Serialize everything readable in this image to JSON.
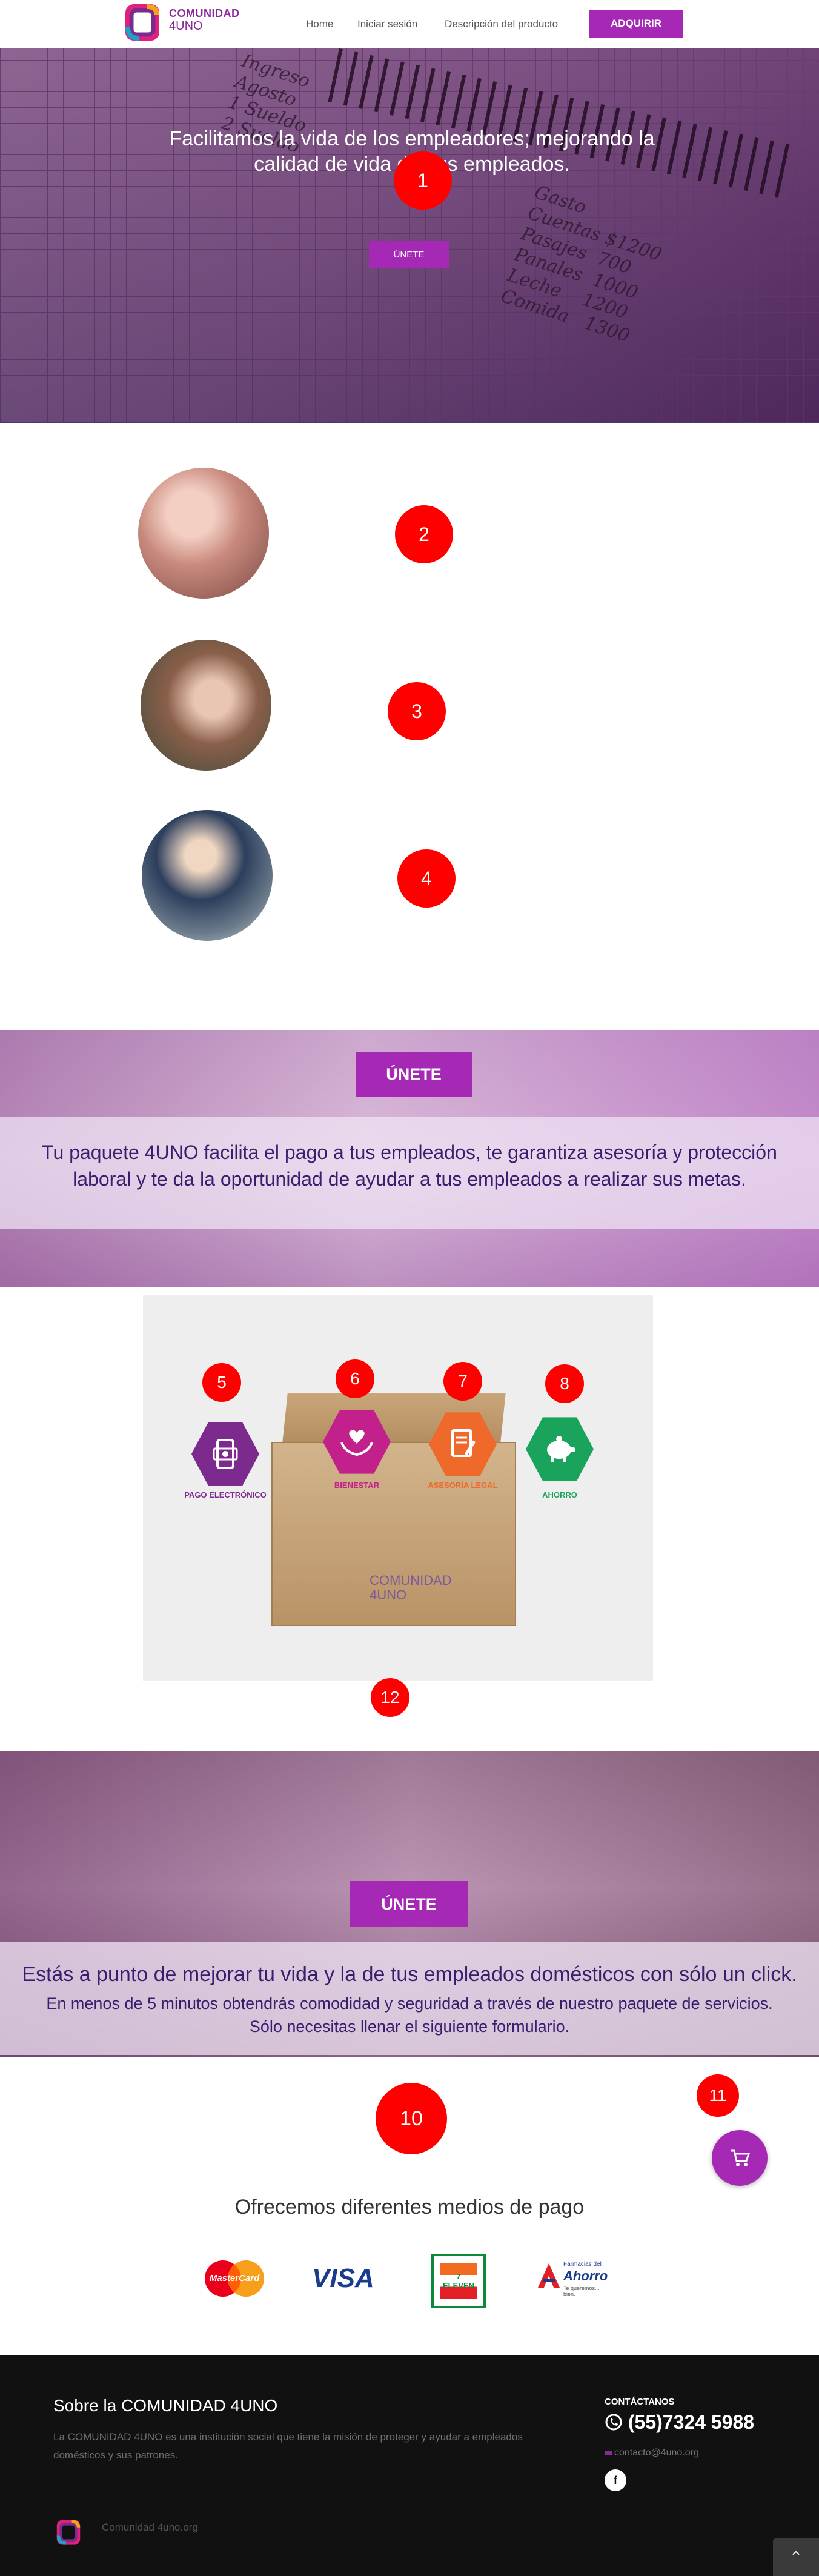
{
  "header": {
    "logo_line1": "COMUNIDAD",
    "logo_line2": "4UNO",
    "nav": [
      "Home",
      "Iniciar sesión",
      "Descripción del producto"
    ],
    "cta": "ADQUIRIR"
  },
  "hero": {
    "title": "Facilitamos la vida de los empleadores; mejorando la calidad de vida de sus empleados.",
    "button": "ÚNETE",
    "handwriting_left": "Ingreso\nAgosto\n1 Sueldo\n2 Sueldo",
    "handwriting_right": "Gasto\nCuentas $1200\nPasajes  700\nPanales  1000\nLeche    1200\nComida   1300"
  },
  "markers": [
    "1",
    "2",
    "3",
    "4",
    "5",
    "6",
    "7",
    "8",
    "10",
    "11",
    "12"
  ],
  "band1": {
    "button": "ÚNETE",
    "text": "Tu paquete 4UNO facilita el pago a tus empleados, te garantiza asesoría y protección laboral y te da la oportunidad de ayudar a tus empleados a realizar sus metas."
  },
  "package": {
    "box_logo_line1": "COMUNIDAD",
    "box_logo_line2": "4UNO",
    "services": [
      {
        "label": "PAGO ELECTRÓNICO",
        "icon": "mobile-payment-icon",
        "color": "#7c2a8e"
      },
      {
        "label": "BIENESTAR",
        "icon": "heart-hands-icon",
        "color": "#c2208a"
      },
      {
        "label": "ASESORÍA LEGAL",
        "icon": "legal-document-icon",
        "color": "#ef6a2a"
      },
      {
        "label": "AHORRO",
        "icon": "piggy-bank-icon",
        "color": "#1aa35a"
      }
    ]
  },
  "band2": {
    "button": "ÚNETE",
    "line1": "Estás a punto de mejorar tu vida y la de tus empleados domésticos con sólo un click.",
    "line2": "En menos de 5 minutos obtendrás comodidad y seguridad a través de nuestro paquete de servicios.",
    "line3": "Sólo necesitas llenar el siguiente formulario."
  },
  "payments": {
    "title": "Ofrecemos diferentes medios de pago",
    "mastercard": "MasterCard",
    "visa": "VISA",
    "seven_eleven": "7 ELEVEN",
    "ahorro_line1": "Farmacias del",
    "ahorro_line2": "Ahorro",
    "ahorro_tag": "Te queremos... bien."
  },
  "footer": {
    "title": "Sobre la COMUNIDAD 4UNO",
    "description": "La COMUNIDAD 4UNO es una institución social que tiene la misión de proteger y ayudar a empleados domésticos y sus patrones.",
    "contact_label": "CONTÁCTANOS",
    "phone": "(55)7324 5988",
    "email": "contacto@4uno.org",
    "facebook": "f",
    "site": "Comunidad 4uno.org"
  },
  "colors": {
    "brand_purple": "#a629b5",
    "marker_red": "#ff0000",
    "footer_bg": "#111111"
  }
}
